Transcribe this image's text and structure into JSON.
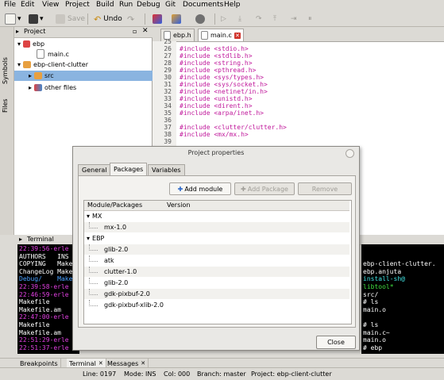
{
  "menu": [
    "File",
    "Edit",
    "View",
    "Project",
    "Build",
    "Run",
    "Debug",
    "Git",
    "Documents",
    "Help"
  ],
  "toolbar": {
    "save": "Save",
    "undo": "Undo"
  },
  "side_tabs": {
    "symbols": "Symbols",
    "files": "Files"
  },
  "project_panel": {
    "title": "Project",
    "tree": [
      {
        "label": "ebp"
      },
      {
        "label": "main.c"
      },
      {
        "label": "ebp-client-clutter"
      },
      {
        "label": "src"
      },
      {
        "label": "other files"
      }
    ]
  },
  "editor": {
    "tabs": [
      "ebp.h",
      "main.c"
    ],
    "line_numbers": [
      "25",
      "26",
      "27",
      "28",
      "29",
      "30",
      "31",
      "32",
      "33",
      "34",
      "35",
      "36",
      "37",
      "38",
      "39"
    ],
    "lines": [
      "",
      "#include <stdio.h>",
      "#include <stdlib.h>",
      "#include <string.h>",
      "#include <pthread.h>",
      "#include <sys/types.h>",
      "#include <sys/socket.h>",
      "#include <netinet/in.h>",
      "#include <unistd.h>",
      "#include <dirent.h>",
      "#include <arpa/inet.h>",
      "",
      "#include <clutter/clutter.h>",
      "#include <mx/mx.h>",
      ""
    ]
  },
  "terminal": {
    "title": "Terminal",
    "left_lines": [
      {
        "text": "22:39:56-erle",
        "color": "#e040e0"
      },
      {
        "text": "AUTHORS   INS",
        "color": "#ffffff"
      },
      {
        "text": "COPYING   Make",
        "color": "#ffffff"
      },
      {
        "text": "ChangeLog Make",
        "color": "#ffffff"
      },
      {
        "text": "Debug/    Make",
        "color": "#4aa0ff"
      },
      {
        "text": "22:39:58-erle",
        "color": "#e040e0"
      },
      {
        "text": "22:46:59-erle",
        "color": "#e040e0"
      },
      {
        "text": "Makefile",
        "color": "#ffffff"
      },
      {
        "text": "Makefile.am",
        "color": "#ffffff"
      },
      {
        "text": "22:47:00-erle",
        "color": "#e040e0"
      },
      {
        "text": "Makefile",
        "color": "#ffffff"
      },
      {
        "text": "Makefile.am",
        "color": "#ffffff"
      },
      {
        "text": "22:51:29-erle",
        "color": "#e040e0"
      },
      {
        "text": "22:51:37-erle",
        "color": "#e040e0"
      }
    ],
    "right_lines": [
      {
        "text": "",
        "color": "#ffffff"
      },
      {
        "text": "",
        "color": "#ffffff"
      },
      {
        "text": "ebp-client-clutter.",
        "color": "#ffffff"
      },
      {
        "text": "ebp.anjuta",
        "color": "#ffffff"
      },
      {
        "text": "install-sh@",
        "color": "#40e0e0"
      },
      {
        "text": "libtool*",
        "color": "#40e040"
      },
      {
        "text": "src/",
        "color": "#ffffff"
      },
      {
        "text": "# ls",
        "color": "#ffffff"
      },
      {
        "text": "main.o",
        "color": "#ffffff"
      },
      {
        "text": "",
        "color": "#ffffff"
      },
      {
        "text": "# ls",
        "color": "#ffffff"
      },
      {
        "text": "main.c~",
        "color": "#ffffff"
      },
      {
        "text": "main.o",
        "color": "#ffffff"
      },
      {
        "text": "# ebp",
        "color": "#ffffff"
      }
    ]
  },
  "bottom_tabs": [
    "Breakpoints",
    "Terminal",
    "Messages"
  ],
  "status": {
    "line": "Line: 0197",
    "mode": "Mode: INS",
    "col": "Col: 000",
    "branch": "Branch: master",
    "project": "Project: ebp-client-clutter"
  },
  "dialog": {
    "title": "Project properties",
    "tabs": [
      "General",
      "Packages",
      "Variables"
    ],
    "buttons": {
      "add_module": "Add module",
      "add_package": "Add Package",
      "remove": "Remove",
      "close": "Close"
    },
    "columns": [
      "Module/Packages",
      "Version"
    ],
    "rows": [
      {
        "label": "MX",
        "kind": "module",
        "expanded": true
      },
      {
        "label": "mx-1.0",
        "kind": "package"
      },
      {
        "label": "EBP",
        "kind": "module",
        "expanded": true
      },
      {
        "label": "glib-2.0",
        "kind": "package"
      },
      {
        "label": "atk",
        "kind": "package"
      },
      {
        "label": "clutter-1.0",
        "kind": "package"
      },
      {
        "label": "glib-2.0",
        "kind": "package"
      },
      {
        "label": "gdk-pixbuf-2.0",
        "kind": "package"
      },
      {
        "label": "gdk-pixbuf-xlib-2.0",
        "kind": "package"
      }
    ]
  }
}
